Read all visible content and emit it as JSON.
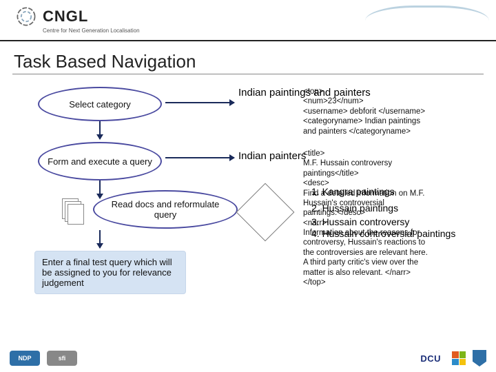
{
  "header": {
    "org": "CNGL",
    "tagline": "Centre for Next Generation Localisation"
  },
  "title": "Task Based Navigation",
  "flow": {
    "select_category": "Select category",
    "form_query": "Form and execute a query",
    "read_reform": "Read docs and reformulate query",
    "final": "Enter a final test query which will be assigned to you for relevance judgement"
  },
  "outputs": {
    "category_label": "Indian paintings and painters",
    "painters_label": "Indian painters"
  },
  "xml": {
    "l1": "<top>",
    "l2": "<num>23</num>",
    "l3": "<username> debforit </username>",
    "l4": "<categoryname> Indian paintings",
    "l5": "and painters </categoryname>",
    "l6": "<title>",
    "l7": "M.F. Hussain controversy",
    "l8": "paintings</title>",
    "l9": "<desc>",
    "l10": "Find a detailed information on M.F.",
    "l11": "Hussain's controversial",
    "l12": "paintings.</desc>",
    "l13": "<narr>",
    "l14": "Information about the reasons for",
    "l15": "controversy, Hussain's reactions to",
    "l16": "the controversies are relevant here.",
    "l17": "A third party critic's view over the",
    "l18": "matter is also relevant. </narr>",
    "l19": "</top>"
  },
  "suggestions": {
    "s1": "1. Kangra paintings",
    "s2": "2. Hussain paintings",
    "s3": "3. Hussain controversy",
    "s4": "4. Hussain controversial paintings"
  },
  "footer": {
    "ndp": "NDP",
    "sfi": "sfi",
    "dcu": "DCU"
  }
}
